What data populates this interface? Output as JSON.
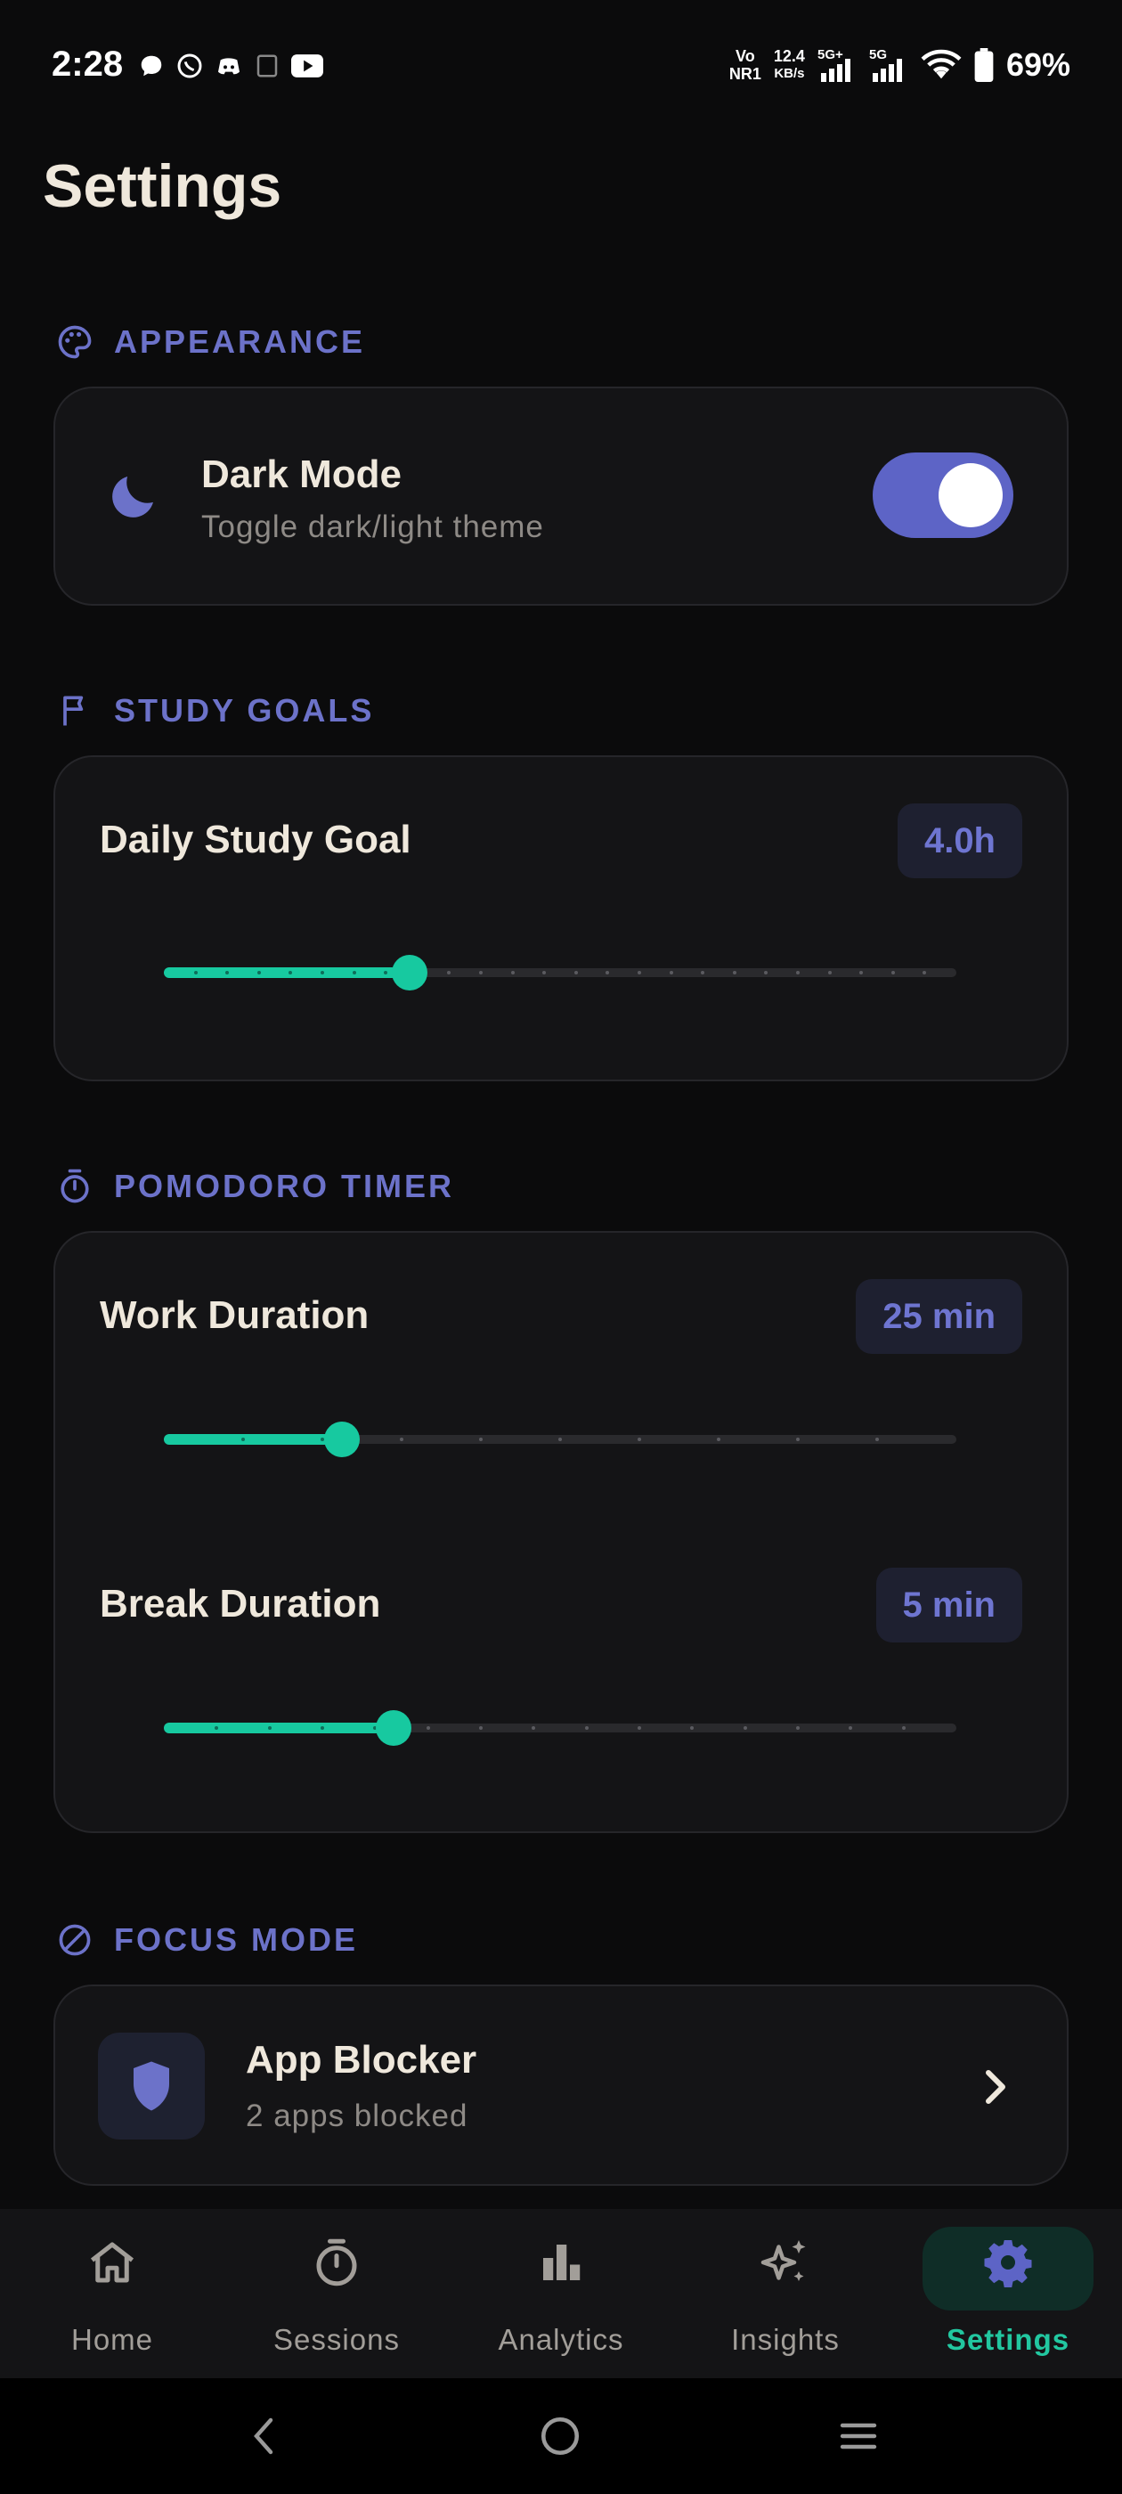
{
  "status_bar": {
    "time": "2:28",
    "net_line1": "Vo\nNR1",
    "speed": "12.4",
    "speed_unit": "KB/s",
    "sig1": "5G+",
    "sig2": "5G",
    "battery": "69%"
  },
  "page": {
    "title": "Settings"
  },
  "appearance": {
    "header": "APPEARANCE",
    "icon": "palette-icon",
    "dark_mode": {
      "title": "Dark Mode",
      "subtitle": "Toggle dark/light theme",
      "enabled": true
    }
  },
  "study_goals": {
    "header": "STUDY GOALS",
    "icon": "flag-icon",
    "daily_goal": {
      "title": "Daily Study Goal",
      "value_label": "4.0h",
      "fraction": 0.31,
      "ticks": 24
    }
  },
  "pomodoro": {
    "header": "POMODORO TIMER",
    "icon": "timer-icon",
    "work": {
      "title": "Work Duration",
      "value_label": "25 min",
      "fraction": 0.225,
      "ticks": 9
    },
    "break": {
      "title": "Break Duration",
      "value_label": "5 min",
      "fraction": 0.29,
      "ticks": 14
    }
  },
  "focus_mode": {
    "header": "FOCUS MODE",
    "icon": "block-icon",
    "app_blocker": {
      "title": "App Blocker",
      "subtitle": "2 apps blocked"
    }
  },
  "bottom_nav": {
    "items": [
      {
        "label": "Home",
        "icon": "home-icon",
        "active": false
      },
      {
        "label": "Sessions",
        "icon": "stopwatch-icon",
        "active": false
      },
      {
        "label": "Analytics",
        "icon": "bar-chart-icon",
        "active": false
      },
      {
        "label": "Insights",
        "icon": "sparkles-icon",
        "active": false
      },
      {
        "label": "Settings",
        "icon": "gear-icon",
        "active": true
      }
    ]
  },
  "colors": {
    "accent": "#6c72c9",
    "teal": "#17c9a0",
    "background": "#0b0b0c",
    "card": "#141416"
  }
}
